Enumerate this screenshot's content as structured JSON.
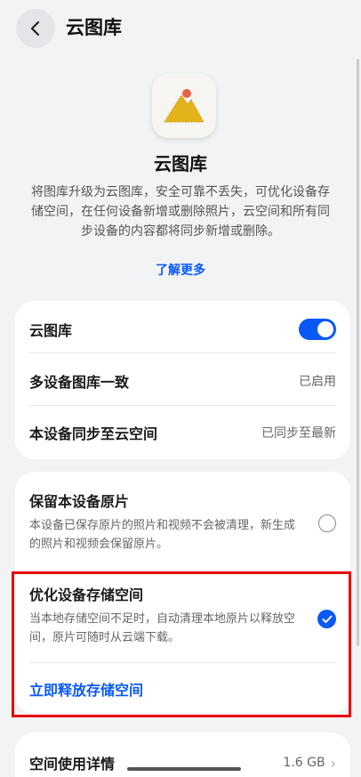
{
  "header": {
    "title": "云图库"
  },
  "hero": {
    "title": "云图库",
    "description": "将图库升级为云图库，安全可靠不丢失，可优化设备存储空间，在任何设备新增或删除照片，云空间和所有同步设备的内容都将同步新增或删除。",
    "learn_more": "了解更多"
  },
  "settings": {
    "cloud_gallery_label": "云图库",
    "cloud_gallery_enabled": true,
    "multi_device_label": "多设备图库一致",
    "multi_device_value": "已启用",
    "sync_label": "本设备同步至云空间",
    "sync_value": "已同步至最新"
  },
  "storage_options": {
    "keep_original": {
      "title": "保留本设备原片",
      "description": "本设备已保存原片的照片和视频不会被清理，新生成的照片和视频会保留原片。",
      "selected": false
    },
    "optimize": {
      "title": "优化设备存储空间",
      "description": "当本地存储空间不足时，自动清理本地原片以释放空间，原片可随时从云端下载。",
      "selected": true
    },
    "free_up_link": "立即释放存储空间"
  },
  "usage": {
    "label": "空间使用详情",
    "value": "1.6 GB"
  },
  "colors": {
    "accent": "#0a59f7",
    "highlight": "#e8000b",
    "background": "#f1f3f5"
  }
}
